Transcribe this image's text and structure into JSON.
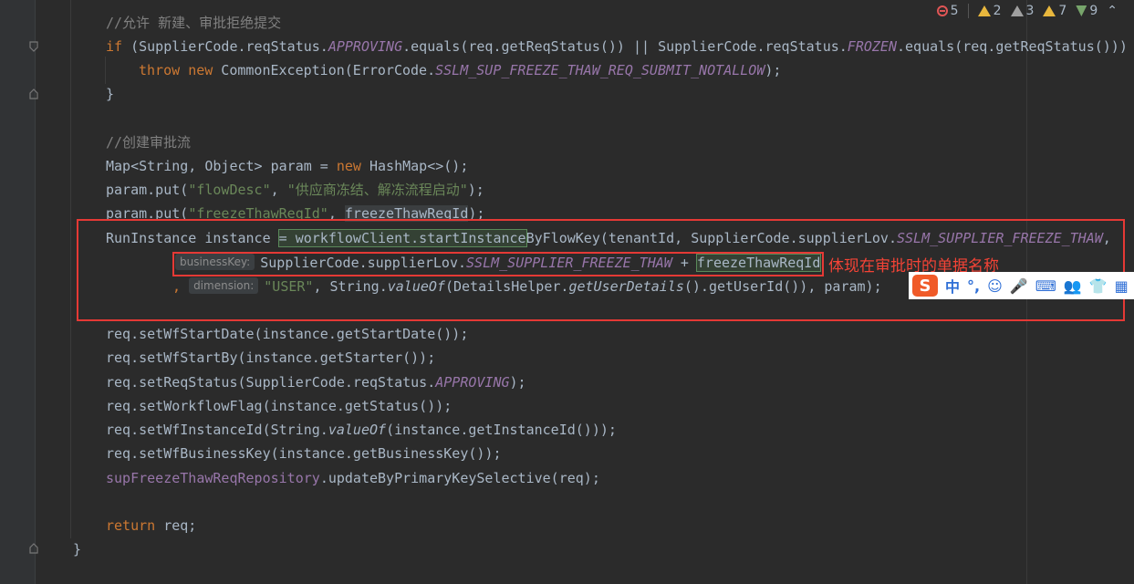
{
  "status": {
    "errors": "5",
    "warnings": "2",
    "weak_warnings": "3",
    "typos": "7",
    "other": "9",
    "collapse": "⌃"
  },
  "code": {
    "comment1": "//允许 新建、审批拒绝提交",
    "if_kw": "if",
    "if_a": " (SupplierCode.reqStatus.",
    "if_f1": "APPROVING",
    "if_b": ".equals(req.getReqStatus()) || SupplierCode.reqStatus.",
    "if_f2": "FROZEN",
    "if_c": ".equals(req.getReqStatus()))",
    "throw_kw": "throw",
    "new_kw": "new",
    "throw_a": " CommonException(ErrorCode.",
    "throw_f": "SSLM_SUP_FREEZE_THAW_REQ_SUBMIT_NOTALLOW",
    "throw_b": ");",
    "close_brace": "}",
    "comment2": "//创建审批流",
    "map_a": "Map<String, Object> param = ",
    "map_new": "new",
    "map_b": " HashMap<>();",
    "put1_a": "param.put(",
    "put1_s1": "\"flowDesc\"",
    "put1_sep": ", ",
    "put1_s2": "\"供应商冻结、解冻流程启动\"",
    "put1_end": ");",
    "put2_a": "param.put(",
    "put2_s1": "\"freezeThawReqId\"",
    "put2_sep": ", ",
    "put2_v": "freezeThawReqId",
    "put2_end": ");",
    "run_a": "RunInstance instance ",
    "run_hl": "= workflowClient.startInstance",
    "run_b": "ByFlowKey(tenantId, SupplierCode.supplierLov.",
    "run_f": "SSLM_SUPPLIER_FREEZE_THAW",
    "run_c": ",",
    "bk_hint": "businessKey:",
    "bk_a": "SupplierCode.supplierLov.",
    "bk_f": "SSLM_SUPPLIER_FREEZE_THAW",
    "bk_b": " + ",
    "bk_v": "freezeThawReqId",
    "dim_comma": ",",
    "dim_hint": "dimension:",
    "dim_s": "\"USER\"",
    "dim_a": ", String.",
    "dim_fn": "valueOf",
    "dim_b": "(DetailsHelper.",
    "dim_fn2": "getUserDetails",
    "dim_c": "().getUserId()), param);",
    "l1": "req.setWfStartDate(instance.getStartDate());",
    "l2": "req.setWfStartBy(instance.getStarter());",
    "l3a": "req.setReqStatus(SupplierCode.reqStatus.",
    "l3f": "APPROVING",
    "l3b": ");",
    "l4": "req.setWorkflowFlag(instance.getStatus());",
    "l5a": "req.setWfInstanceId(String.",
    "l5fn": "valueOf",
    "l5b": "(instance.getInstanceId()));",
    "l6": "req.setWfBusinessKey(instance.getBusinessKey());",
    "l7a": "supFreezeThawReqRepository",
    "l7b": ".updateByPrimaryKeySelective(req);",
    "ret_kw": "return",
    "ret_a": " req;",
    "method_close": "}"
  },
  "annotation": "体现在审批时的单据名称",
  "ime": {
    "logo": "S",
    "mode": "中",
    "punct": "°,",
    "emoji": "☺",
    "voice": "🎤",
    "keyboard": "⌨",
    "user": "👥",
    "skin": "👕",
    "apps": "▦"
  },
  "colors": {
    "background": "#2b2b2b",
    "keyword": "#cc7832",
    "field": "#9876aa",
    "string": "#6a8759",
    "comment": "#808080",
    "annotation_red": "#f44336"
  }
}
